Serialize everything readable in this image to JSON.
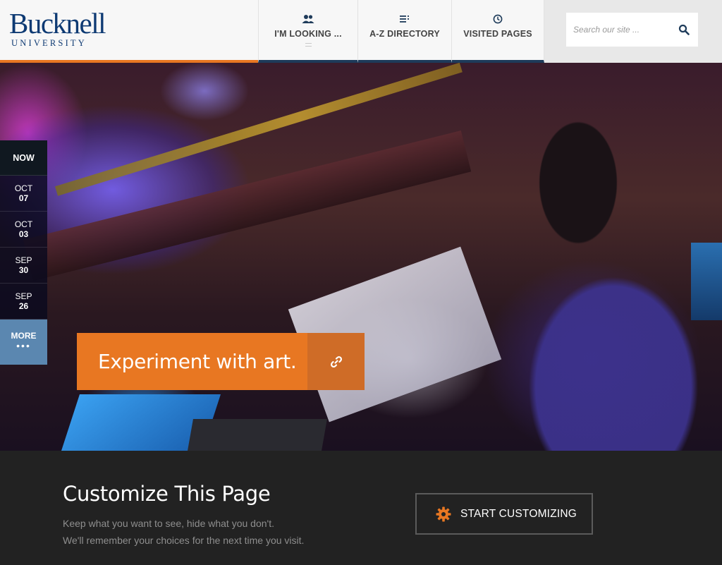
{
  "brand": {
    "name": "Bucknell",
    "subname": "UNIVERSITY",
    "accent": "#e87722",
    "navy": "#0e3a73"
  },
  "nav": {
    "looking": {
      "label": "I'M LOOKING ...",
      "icon": "people-icon"
    },
    "az": {
      "label": "A-Z DIRECTORY",
      "icon": "list-icon"
    },
    "visited": {
      "label": "VISITED PAGES",
      "icon": "clock-icon"
    }
  },
  "search": {
    "placeholder": "Search our site ...",
    "icon": "search-icon"
  },
  "dates": {
    "now": "NOW",
    "items": [
      {
        "month": "OCT",
        "day": "07"
      },
      {
        "month": "OCT",
        "day": "03"
      },
      {
        "month": "SEP",
        "day": "30"
      },
      {
        "month": "SEP",
        "day": "26"
      }
    ],
    "more": "MORE",
    "more_dots": "•••"
  },
  "hero": {
    "cta_text": "Experiment with art.",
    "cta_icon": "link-icon"
  },
  "customize": {
    "title": "Customize This Page",
    "line1": "Keep what you want to see, hide what you don't.",
    "line2": "We'll remember your choices for the next time you visit.",
    "button_label": "START CUSTOMIZING",
    "button_icon": "gear-icon"
  }
}
